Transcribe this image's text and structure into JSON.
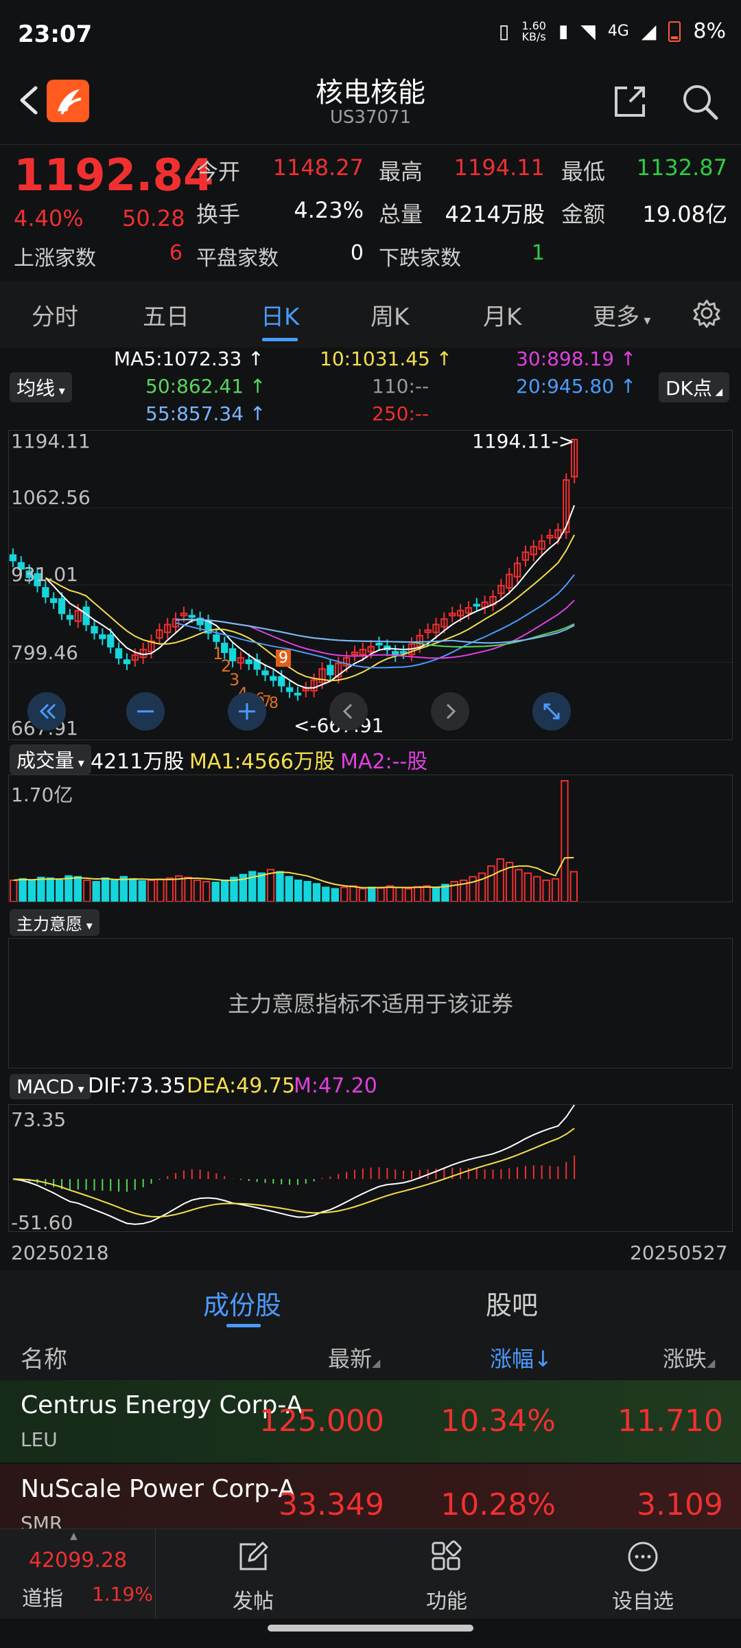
{
  "status_bar": {
    "time": "23:07",
    "speed": "1.60",
    "speed_unit": "KB/s",
    "network": "4G",
    "battery": "8%"
  },
  "header": {
    "title": "核电核能",
    "code": "US37071"
  },
  "quote": {
    "price": "1192.84",
    "change_pct": "4.40%",
    "change": "50.28",
    "stats": [
      {
        "label": "今开",
        "value": "1148.27"
      },
      {
        "label": "最高",
        "value": "1194.11"
      },
      {
        "label": "最低",
        "value": "1132.87"
      },
      {
        "label": "换手",
        "value": "4.23%"
      },
      {
        "label": "总量",
        "value": "4214万股"
      },
      {
        "label": "金额",
        "value": "19.08亿"
      },
      {
        "label": "上涨家数",
        "value": "6"
      },
      {
        "label": "平盘家数",
        "value": "0"
      },
      {
        "label": "下跌家数",
        "value": "1"
      }
    ]
  },
  "tabs": [
    "分时",
    "五日",
    "日K",
    "周K",
    "月K",
    "更多"
  ],
  "active_tab": "日K",
  "kline": {
    "selector": "均线",
    "dk_button": "DK点",
    "ma": [
      {
        "text": "MA5:1072.33 ↑",
        "color": "#ffffff"
      },
      {
        "text": "10:1031.45 ↑",
        "color": "#f5e04a"
      },
      {
        "text": "30:898.19 ↑",
        "color": "#e040e0"
      },
      {
        "text": "50:862.41 ↑",
        "color": "#58d65c"
      },
      {
        "text": "110:--",
        "color": "#9a9a9a"
      },
      {
        "text": "20:945.80 ↑",
        "color": "#4a9bff"
      },
      {
        "text": "55:857.34 ↑",
        "color": "#7ab6ff"
      },
      {
        "text": "250:--",
        "color": "#f03030"
      }
    ],
    "y_labels": [
      "1194.11",
      "1062.56",
      "931.01",
      "799.46",
      "667.91"
    ],
    "high_marker": "1194.11->",
    "low_marker": "<-667.91",
    "nine_turn": [
      "1",
      "2",
      "3",
      "4",
      "5",
      "6",
      "7",
      "8",
      "9"
    ]
  },
  "volume": {
    "selector": "成交量",
    "value": "4211万股",
    "ma1": "MA1:4566万股",
    "ma2": "MA2:--股",
    "y_max": "1.70亿"
  },
  "main_force": {
    "selector": "主力意愿",
    "message": "主力意愿指标不适用于该证券"
  },
  "macd": {
    "selector": "MACD",
    "dif": "DIF:73.35",
    "dea": "DEA:49.75",
    "m": "M:47.20",
    "y_top": "73.35",
    "y_bottom": "-51.60",
    "date_start": "20250218",
    "date_end": "20250527"
  },
  "list_tabs": [
    "成份股",
    "股吧"
  ],
  "active_list_tab": "成份股",
  "columns": [
    "名称",
    "最新",
    "涨幅↓",
    "涨跌"
  ],
  "rows": [
    {
      "name": "Centrus Energy Corp-A",
      "code": "LEU",
      "last": "125.000",
      "pct": "10.34%",
      "chg": "11.710"
    },
    {
      "name": "NuScale Power Corp-A",
      "code": "SMR",
      "last": "33.349",
      "pct": "10.28%",
      "chg": "3.109"
    }
  ],
  "bottom_nav": {
    "index_value": "42099.28",
    "index_name": "道指",
    "index_pct": "1.19%",
    "items": [
      "发帖",
      "功能",
      "设自选"
    ]
  },
  "chart_data": [
    {
      "type": "line",
      "title": "",
      "ylabel": "",
      "ylim": [
        667.91,
        1194.11
      ],
      "x_range": [
        "20250218",
        "20250527"
      ],
      "series": [
        {
          "name": "MA5",
          "last": 1072.33
        },
        {
          "name": "10",
          "last": 1031.45
        },
        {
          "name": "20",
          "last": 945.8
        },
        {
          "name": "30",
          "last": 898.19
        },
        {
          "name": "50",
          "last": 862.41
        },
        {
          "name": "55",
          "last": 857.34
        }
      ],
      "close_approx": [
        975,
        960,
        945,
        930,
        910,
        900,
        880,
        870,
        885,
        860,
        845,
        835,
        820,
        800,
        790,
        805,
        815,
        830,
        850,
        860,
        870,
        880,
        875,
        860,
        845,
        830,
        810,
        795,
        800,
        790,
        780,
        770,
        760,
        750,
        740,
        735,
        745,
        760,
        780,
        770,
        790,
        800,
        810,
        815,
        820,
        825,
        815,
        805,
        810,
        825,
        840,
        850,
        860,
        870,
        880,
        885,
        890,
        895,
        900,
        910,
        930,
        950,
        970,
        990,
        1000,
        1010,
        1020,
        1030,
        1120,
        1192.84
      ]
    },
    {
      "type": "bar",
      "title": "",
      "ylim": [
        0,
        1.7
      ],
      "unit": "亿",
      "values_approx": [
        0.3,
        0.32,
        0.3,
        0.34,
        0.33,
        0.3,
        0.36,
        0.35,
        0.3,
        0.28,
        0.33,
        0.3,
        0.35,
        0.32,
        0.29,
        0.3,
        0.31,
        0.33,
        0.36,
        0.34,
        0.3,
        0.28,
        0.27,
        0.3,
        0.34,
        0.38,
        0.42,
        0.4,
        0.45,
        0.42,
        0.35,
        0.3,
        0.28,
        0.25,
        0.2,
        0.18,
        0.2,
        0.22,
        0.18,
        0.2,
        0.19,
        0.22,
        0.2,
        0.18,
        0.21,
        0.22,
        0.2,
        0.24,
        0.28,
        0.3,
        0.35,
        0.4,
        0.5,
        0.6,
        0.55,
        0.45,
        0.4,
        0.35,
        0.3,
        0.32,
        1.7,
        0.42
      ]
    },
    {
      "type": "line",
      "title": "",
      "ylim": [
        -51.6,
        73.35
      ],
      "series": [
        {
          "name": "DIF",
          "last": 73.35
        },
        {
          "name": "DEA",
          "last": 49.75
        },
        {
          "name": "M",
          "last": 47.2
        }
      ]
    }
  ]
}
